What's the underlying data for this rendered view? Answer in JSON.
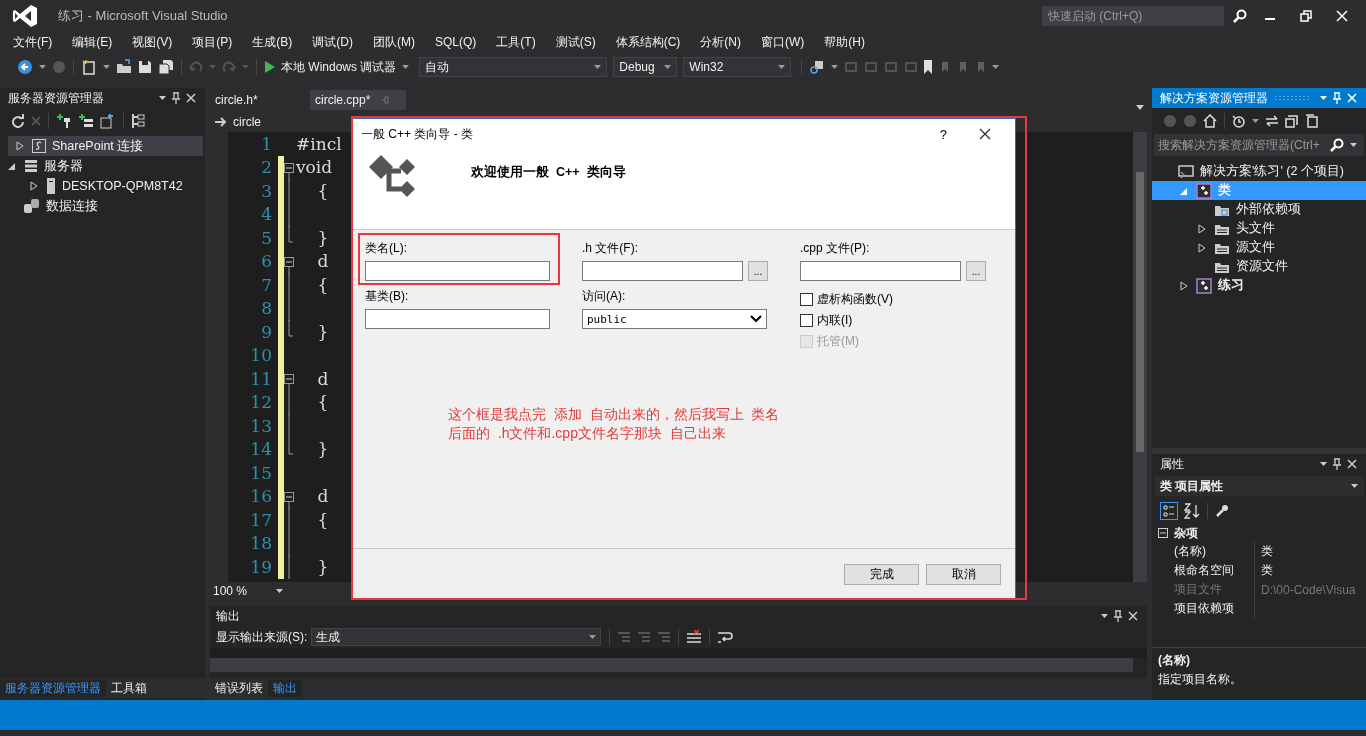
{
  "window": {
    "title": "练习 - Microsoft Visual Studio"
  },
  "quick_launch": {
    "placeholder": "快速启动 (Ctrl+Q)"
  },
  "menu": [
    "文件(F)",
    "编辑(E)",
    "视图(V)",
    "项目(P)",
    "生成(B)",
    "调试(D)",
    "团队(M)",
    "SQL(Q)",
    "工具(T)",
    "测试(S)",
    "体系结构(C)",
    "分析(N)",
    "窗口(W)",
    "帮助(H)"
  ],
  "toolbar": {
    "debugger": "本地 Windows 调试器",
    "combos": [
      {
        "value": "自动",
        "kind": "wide"
      },
      {
        "value": "Debug",
        "kind": "narrow"
      },
      {
        "value": "Win32",
        "kind": "medium"
      }
    ]
  },
  "server_explorer": {
    "title": "服务器资源管理器",
    "tree": [
      {
        "label": "SharePoint 连接",
        "kind": "sharepoint",
        "expanded": false,
        "selected": true
      },
      {
        "label": "服务器",
        "kind": "servers",
        "expanded": true,
        "selected": false,
        "children": [
          {
            "label": "DESKTOP-QPM8T42",
            "kind": "server",
            "expanded": false,
            "selected": false
          }
        ]
      },
      {
        "label": "数据连接",
        "kind": "data",
        "selected": false
      }
    ]
  },
  "left_tabs": [
    {
      "label": "服务器资源管理器",
      "selected": true
    },
    {
      "label": "工具箱",
      "selected": false
    }
  ],
  "editor": {
    "tabs": [
      {
        "label": "circle.h*",
        "selected": false
      },
      {
        "label": "circle.cpp*",
        "selected": true
      }
    ],
    "nav": "circle",
    "zoom": "100 %",
    "lines": [
      {
        "number": "1",
        "code": "#incl",
        "changed": false
      },
      {
        "number": "2",
        "code": "void",
        "changed": true,
        "kind": "start"
      },
      {
        "number": "3",
        "code": "    {",
        "changed": true,
        "kind": "inside"
      },
      {
        "number": "4",
        "changed": true,
        "kind": "inside"
      },
      {
        "number": "5",
        "code": "    }",
        "changed": true,
        "kind": "end"
      },
      {
        "number": "6",
        "code": "    d",
        "changed": true,
        "kind": "start"
      },
      {
        "number": "7",
        "code": "    {",
        "changed": true,
        "kind": "inside"
      },
      {
        "number": "8",
        "changed": true,
        "kind": "inside"
      },
      {
        "number": "9",
        "code": "    }",
        "changed": true,
        "kind": "end"
      },
      {
        "number": "10",
        "changed": true
      },
      {
        "number": "11",
        "code": "    d",
        "changed": true,
        "kind": "start"
      },
      {
        "number": "12",
        "code": "    {",
        "changed": true,
        "kind": "inside"
      },
      {
        "number": "13",
        "changed": true,
        "kind": "inside"
      },
      {
        "number": "14",
        "code": "    }",
        "changed": true,
        "kind": "end"
      },
      {
        "number": "15",
        "changed": true
      },
      {
        "number": "16",
        "code": "    d",
        "changed": true,
        "kind": "start"
      },
      {
        "number": "17",
        "code": "    {",
        "changed": true,
        "kind": "inside"
      },
      {
        "number": "18",
        "changed": true,
        "kind": "inside"
      },
      {
        "number": "19",
        "code": "    }",
        "changed": true,
        "kind": "inside"
      }
    ]
  },
  "output": {
    "title": "输出",
    "source_label": "显示输出来源(S):",
    "source": "生成"
  },
  "bottom_tabs": [
    {
      "label": "错误列表",
      "selected": false
    },
    {
      "label": "输出",
      "selected": true
    }
  ],
  "solution_explorer": {
    "title": "解决方案资源管理器",
    "search_placeholder": "搜索解决方案资源管理器(Ctrl+",
    "tree": [
      {
        "label": "解决方案'练习' (2 个项目)",
        "kind": "solution",
        "selected": false,
        "children": [
          {
            "label": "类",
            "kind": "project",
            "expanded": true,
            "selected": true,
            "children": [
              {
                "label": "外部依赖项",
                "kind": "refs",
                "selected": false
              },
              {
                "label": "头文件",
                "kind": "folder",
                "expanded": false,
                "selected": false
              },
              {
                "label": "源文件",
                "kind": "folder",
                "expanded": false,
                "selected": false
              },
              {
                "label": "资源文件",
                "kind": "folder",
                "selected": false
              }
            ]
          },
          {
            "label": "练习",
            "kind": "project",
            "expanded": false,
            "selected": false
          }
        ]
      }
    ]
  },
  "properties": {
    "title": "属性",
    "object": "类 项目属性",
    "category": {
      "label": "杂项",
      "expanded": true
    },
    "rows": [
      {
        "name": "(名称)",
        "value": "类",
        "disabled": false
      },
      {
        "name": "根命名空间",
        "value": "类",
        "disabled": false
      },
      {
        "name": "项目文件",
        "value": "D:\\00-Code\\Visua",
        "disabled": true
      },
      {
        "name": "项目依赖项",
        "disabled": false
      }
    ],
    "description": {
      "title": "(名称)",
      "text": "指定项目名称。"
    }
  },
  "dialog": {
    "title": "一般 C++ 类向导 - 类",
    "help": "?",
    "heading": "欢迎使用一般  C++  类向导",
    "class_name": {
      "label": "类名(L):"
    },
    "h_file": {
      "label": ".h 文件(F):",
      "browse": "..."
    },
    "cpp_file": {
      "label": ".cpp 文件(P):",
      "browse": "..."
    },
    "base_class": {
      "label": "基类(B):"
    },
    "access": {
      "label": "访问(A):",
      "value": "public"
    },
    "options": [
      {
        "label": "虚析构函数(V)",
        "checked": false,
        "disabled": false
      },
      {
        "label": "内联(I)",
        "checked": false,
        "disabled": false
      },
      {
        "label": "托管(M)",
        "checked": false,
        "disabled": true
      }
    ],
    "buttons": [
      "完成",
      "取消"
    ]
  },
  "annotation": {
    "lines": [
      "这个框是我点完  添加  自动出来的，然后我写上  类名",
      "后面的  .h文件和.cpp文件名字那块  自己出来"
    ]
  }
}
